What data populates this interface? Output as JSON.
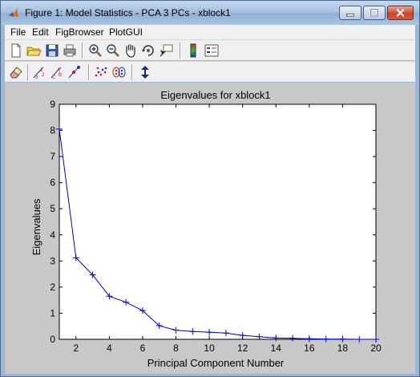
{
  "window": {
    "title": "Figure 1: Model Statistics - PCA 3 PCs - xblock1",
    "controls": [
      "minimize",
      "maximize",
      "close"
    ]
  },
  "menu": [
    "File",
    "Edit",
    "FigBrowser",
    "PlotGUI"
  ],
  "toolbar_row1": [
    "new-figure-icon",
    "open-folder-icon",
    "save-icon",
    "print-icon",
    "zoom-in-icon",
    "zoom-out-icon",
    "pan-hand-icon",
    "rotate-3d-icon",
    "data-cursor-icon",
    "colorbar-icon",
    "legend-icon"
  ],
  "toolbar_row2": [
    "eraser-icon",
    "label-numbers-icon",
    "label-abc-icon",
    "label-class-icon",
    "scatter-points-icon",
    "class-groups-icon",
    "vertical-arrow-icon"
  ],
  "colors": {
    "line": "#0000cc",
    "figure_background": "#c8c8c8",
    "axes_background": "#ffffff"
  },
  "chart_data": {
    "type": "line",
    "title": "Eigenvalues for xblock1",
    "xlabel": "Principal Component Number",
    "ylabel": "Eigenvalues",
    "xlim": [
      1,
      20
    ],
    "ylim": [
      0,
      9
    ],
    "xticks": [
      2,
      4,
      6,
      8,
      10,
      12,
      14,
      16,
      18,
      20
    ],
    "yticks": [
      0,
      1,
      2,
      3,
      4,
      5,
      6,
      7,
      8,
      9
    ],
    "marker": "+",
    "grid": false,
    "x": [
      1,
      2,
      3,
      4,
      5,
      6,
      7,
      8,
      9,
      10,
      11,
      12,
      13,
      14,
      15,
      16,
      17,
      18,
      19,
      20
    ],
    "values": [
      8.05,
      3.12,
      2.47,
      1.65,
      1.42,
      1.1,
      0.52,
      0.35,
      0.3,
      0.27,
      0.24,
      0.15,
      0.1,
      0.05,
      0.04,
      0.02,
      0.01,
      0.01,
      0.0,
      0.0
    ]
  }
}
